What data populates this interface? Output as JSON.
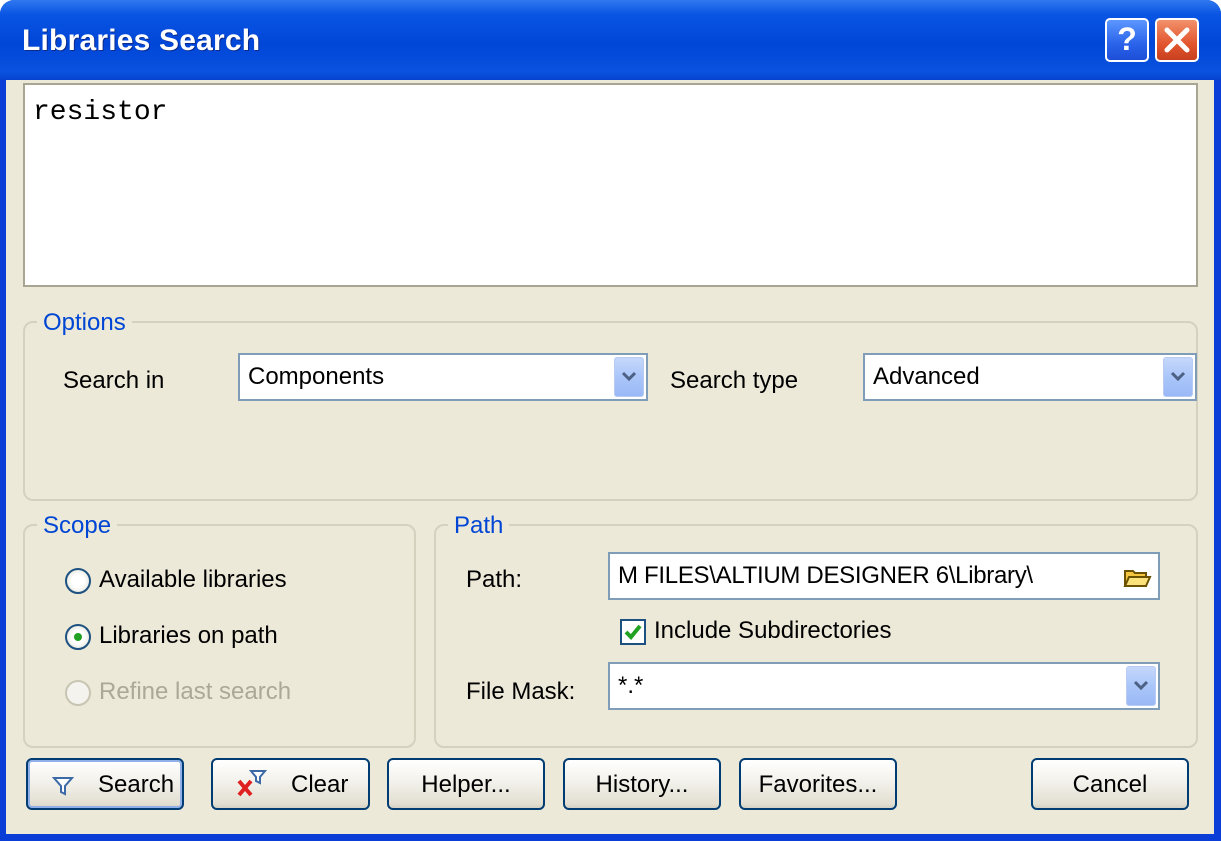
{
  "window": {
    "title": "Libraries Search",
    "help_label": "?",
    "close_label": "×"
  },
  "query": {
    "text": "resistor"
  },
  "options": {
    "legend": "Options",
    "search_in_label": "Search in",
    "search_in_value": "Components",
    "search_type_label": "Search type",
    "search_type_value": "Advanced"
  },
  "scope": {
    "legend": "Scope",
    "items": [
      {
        "label": "Available libraries",
        "selected": false,
        "enabled": true
      },
      {
        "label": "Libraries on path",
        "selected": true,
        "enabled": true
      },
      {
        "label": "Refine last search",
        "selected": false,
        "enabled": false
      }
    ]
  },
  "path": {
    "legend": "Path",
    "path_label": "Path:",
    "path_value": "M FILES\\ALTIUM DESIGNER 6\\Library\\",
    "include_subdirs_label": "Include Subdirectories",
    "include_subdirs_checked": true,
    "file_mask_label": "File Mask:",
    "file_mask_value": "*.*"
  },
  "buttons": {
    "search": "Search",
    "clear": "Clear",
    "helper": "Helper...",
    "history": "History...",
    "favorites": "Favorites...",
    "cancel": "Cancel"
  },
  "icons": {
    "search": "filter-funnel-icon",
    "clear": "red-x-funnel-icon",
    "browse": "open-folder-icon",
    "dropdown": "chevron-down-icon"
  },
  "colors": {
    "titlebar": "#0046d8",
    "legend_text": "#0046d5",
    "dialog_bg": "#ece9d8",
    "check_green": "#21a121"
  }
}
